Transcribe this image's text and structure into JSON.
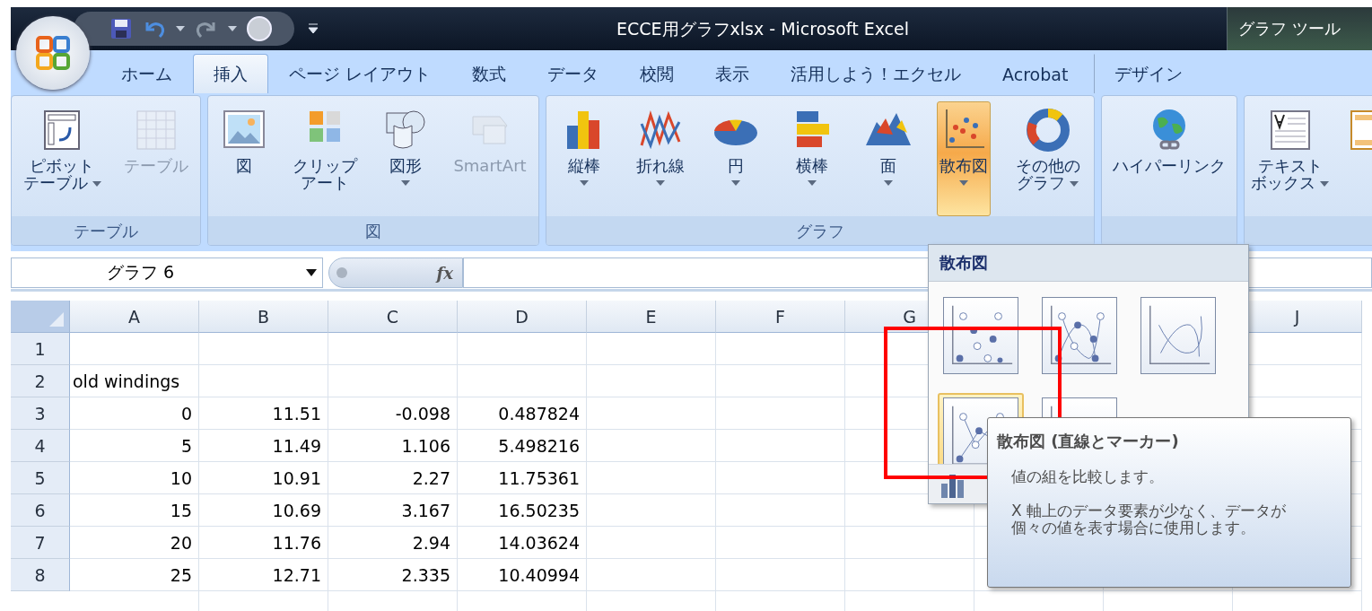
{
  "window": {
    "title": "ECCE用グラフxlsx - Microsoft Excel",
    "context_label": "グラフ ツール"
  },
  "tabs": [
    {
      "label": "ホーム",
      "selected": false,
      "kind": "normal"
    },
    {
      "label": "挿入",
      "selected": true,
      "kind": "normal"
    },
    {
      "label": "ページ レイアウト",
      "selected": false,
      "kind": "normal"
    },
    {
      "label": "数式",
      "selected": false,
      "kind": "normal"
    },
    {
      "label": "データ",
      "selected": false,
      "kind": "normal"
    },
    {
      "label": "校閲",
      "selected": false,
      "kind": "normal"
    },
    {
      "label": "表示",
      "selected": false,
      "kind": "normal"
    },
    {
      "label": "活用しよう！エクセル",
      "selected": false,
      "kind": "normal"
    },
    {
      "label": "Acrobat",
      "selected": false,
      "kind": "normal"
    },
    {
      "label": "デザイン",
      "selected": false,
      "kind": "contextual"
    }
  ],
  "ribbon": {
    "groups": [
      {
        "label": "テーブル",
        "buttons": [
          {
            "lines": [
              "ピボット",
              "テーブル"
            ],
            "menu": true,
            "disabled": false,
            "pressed": false
          },
          {
            "lines": [
              "テーブル"
            ],
            "menu": false,
            "disabled": true,
            "pressed": false
          }
        ]
      },
      {
        "label": "図",
        "buttons": [
          {
            "lines": [
              "図"
            ],
            "menu": false,
            "disabled": false,
            "pressed": false
          },
          {
            "lines": [
              "クリップ",
              "アート"
            ],
            "menu": false,
            "disabled": false,
            "pressed": false
          },
          {
            "lines": [
              "図形"
            ],
            "menu": true,
            "disabled": false,
            "pressed": false
          },
          {
            "lines": [
              "SmartArt"
            ],
            "menu": false,
            "disabled": true,
            "pressed": false
          }
        ]
      },
      {
        "label": "グラフ",
        "buttons": [
          {
            "lines": [
              "縦棒"
            ],
            "menu": true,
            "disabled": false,
            "pressed": false
          },
          {
            "lines": [
              "折れ線"
            ],
            "menu": true,
            "disabled": false,
            "pressed": false
          },
          {
            "lines": [
              "円"
            ],
            "menu": true,
            "disabled": false,
            "pressed": false
          },
          {
            "lines": [
              "横棒"
            ],
            "menu": true,
            "disabled": false,
            "pressed": false
          },
          {
            "lines": [
              "面"
            ],
            "menu": true,
            "disabled": false,
            "pressed": false
          },
          {
            "lines": [
              "散布図"
            ],
            "menu": true,
            "disabled": false,
            "pressed": true
          },
          {
            "lines": [
              "その他の",
              "グラフ"
            ],
            "menu": true,
            "disabled": false,
            "pressed": false
          }
        ]
      },
      {
        "buttons": [
          {
            "lines": [
              "ハイパーリンク"
            ],
            "menu": false,
            "disabled": false,
            "pressed": false
          }
        ]
      },
      {
        "buttons": [
          {
            "lines": [
              "テキスト",
              "ボックス"
            ],
            "menu": true,
            "disabled": false,
            "pressed": false
          },
          {
            "menu": false,
            "disabled": false,
            "pressed": false
          }
        ]
      }
    ]
  },
  "formula_bar": {
    "name_box": "グラフ 6",
    "function_label": "fx"
  },
  "sheet": {
    "columns": [
      "A",
      "B",
      "C",
      "D",
      "E",
      "F",
      "G",
      "J"
    ],
    "rows": [
      {
        "number": "1",
        "cells": []
      },
      {
        "number": "2",
        "cells": [
          {
            "text": "old windings",
            "kind": "text"
          }
        ]
      },
      {
        "number": "3",
        "cells": [
          {
            "text": "0",
            "kind": "number"
          },
          {
            "text": "11.51",
            "kind": "number"
          },
          {
            "text": "-0.098",
            "kind": "number"
          },
          {
            "text": "0.487824",
            "kind": "number"
          }
        ]
      },
      {
        "number": "4",
        "cells": [
          {
            "text": "5",
            "kind": "number"
          },
          {
            "text": "11.49",
            "kind": "number"
          },
          {
            "text": "1.106",
            "kind": "number"
          },
          {
            "text": "5.498216",
            "kind": "number"
          }
        ]
      },
      {
        "number": "5",
        "cells": [
          {
            "text": "10",
            "kind": "number"
          },
          {
            "text": "10.91",
            "kind": "number"
          },
          {
            "text": "2.27",
            "kind": "number"
          },
          {
            "text": "11.75361",
            "kind": "number"
          }
        ]
      },
      {
        "number": "6",
        "cells": [
          {
            "text": "15",
            "kind": "number"
          },
          {
            "text": "10.69",
            "kind": "number"
          },
          {
            "text": "3.167",
            "kind": "number"
          },
          {
            "text": "16.50235",
            "kind": "number"
          }
        ]
      },
      {
        "number": "7",
        "cells": [
          {
            "text": "20",
            "kind": "number"
          },
          {
            "text": "11.76",
            "kind": "number"
          },
          {
            "text": "2.94",
            "kind": "number"
          },
          {
            "text": "14.03624",
            "kind": "number"
          }
        ]
      },
      {
        "number": "8",
        "cells": [
          {
            "text": "25",
            "kind": "number"
          },
          {
            "text": "12.71",
            "kind": "number"
          },
          {
            "text": "2.335",
            "kind": "number"
          },
          {
            "text": "10.40994",
            "kind": "number"
          }
        ]
      }
    ]
  },
  "chart_gallery": {
    "title": "散布図",
    "items": [
      {
        "selected": false
      },
      {
        "selected": false
      },
      {
        "selected": false
      },
      {
        "selected": true
      },
      {
        "selected": false
      }
    ]
  },
  "tooltip": {
    "title": "散布図 (直線とマーカー)",
    "lines": [
      "値の組を比較します。",
      "X 軸上のデータ要素が少なく、データが個々の値を表す場合に使用します。"
    ]
  }
}
